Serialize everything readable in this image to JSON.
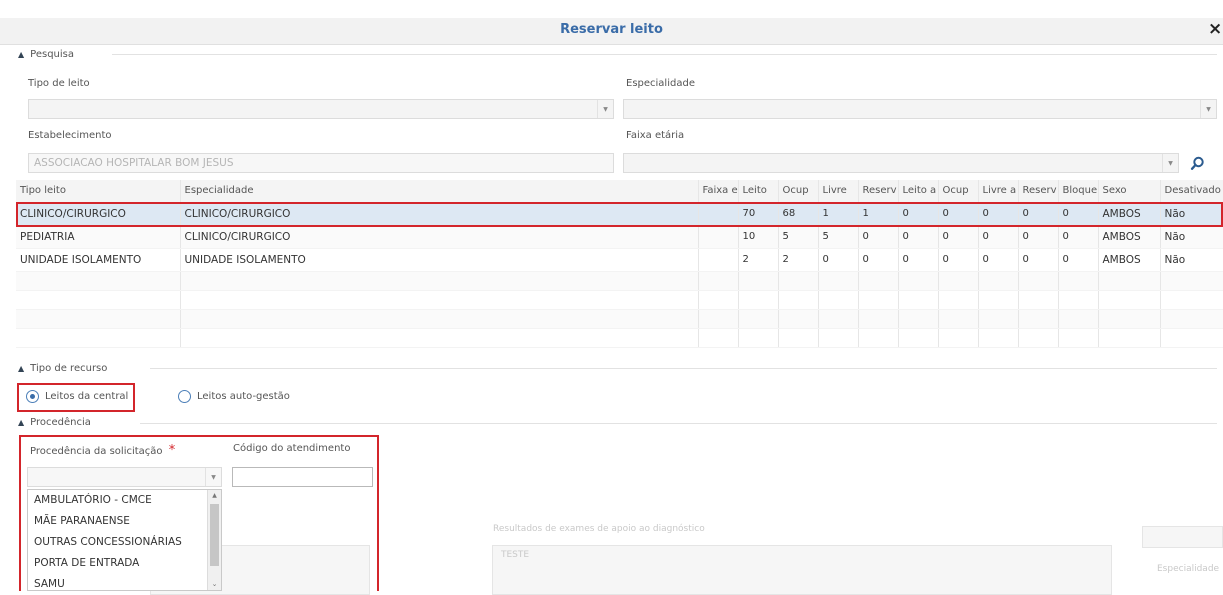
{
  "dialog": {
    "title": "Reservar leito",
    "close": "×"
  },
  "pesquisa": {
    "header": "Pesquisa",
    "tipo_leito_label": "Tipo de leito",
    "especialidade_label": "Especialidade",
    "estabelecimento_label": "Estabelecimento",
    "estabelecimento_value": "ASSOCIACAO HOSPITALAR BOM JESUS",
    "faixa_etaria_label": "Faixa etária"
  },
  "table": {
    "columns": [
      "Tipo leito",
      "Especialidade",
      "Faixa e",
      "Leito",
      "Ocup",
      "Livre",
      "Reserv",
      "Leito a",
      "Ocup",
      "Livre a",
      "Reserv",
      "Bloque",
      "Sexo",
      "Desativado"
    ],
    "rows": [
      [
        "CLINICO/CIRURGICO",
        "CLINICO/CIRURGICO",
        "",
        "70",
        "68",
        "1",
        "1",
        "0",
        "0",
        "0",
        "0",
        "0",
        "AMBOS",
        "Não"
      ],
      [
        "PEDIATRIA",
        "CLINICO/CIRURGICO",
        "",
        "10",
        "5",
        "5",
        "0",
        "0",
        "0",
        "0",
        "0",
        "0",
        "AMBOS",
        "Não"
      ],
      [
        "UNIDADE ISOLAMENTO",
        "UNIDADE ISOLAMENTO",
        "",
        "2",
        "2",
        "0",
        "0",
        "0",
        "0",
        "0",
        "0",
        "0",
        "AMBOS",
        "Não"
      ]
    ],
    "empty_rows": 4,
    "selected_row": 0
  },
  "recurso": {
    "header": "Tipo de recurso",
    "option_central": "Leitos da central",
    "option_auto": "Leitos auto-gestão",
    "selected": "central"
  },
  "procedencia": {
    "header": "Procedência",
    "solicitacao_label": "Procedência da solicitação",
    "required_mark": "*",
    "codigo_label": "Código do atendimento",
    "codigo_value": "",
    "options": [
      "AMBULATÓRIO - CMCE",
      "MÃE PARANAENSE",
      "OUTRAS CONCESSIONÁRIAS",
      "PORTA DE ENTRADA",
      "SAMU"
    ]
  },
  "background": {
    "exames_label": "Resultados de exames de apoio ao diagnóstico",
    "exames_value": "TESTE",
    "especialidade_label": "Especialidade"
  },
  "colors": {
    "accent": "#3a6ca8",
    "highlight": "#d3252b",
    "selected_row": "#dde8f3"
  }
}
